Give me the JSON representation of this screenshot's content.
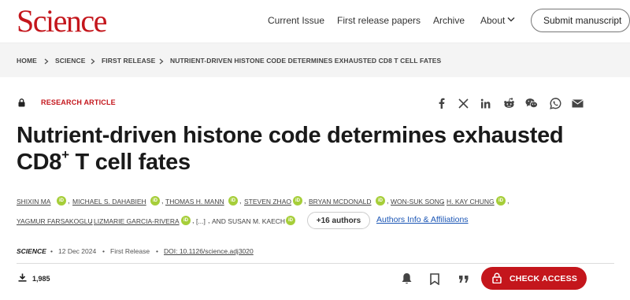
{
  "header": {
    "logo": "Science",
    "nav": [
      "Current Issue",
      "First release papers",
      "Archive",
      "About"
    ],
    "submit": "Submit manuscript"
  },
  "breadcrumb": [
    "HOME",
    "SCIENCE",
    "FIRST RELEASE",
    "NUTRIENT-DRIVEN HISTONE CODE DETERMINES EXHAUSTED CD8 T CELL FATES"
  ],
  "article": {
    "type": "RESEARCH ARTICLE",
    "title_main": "Nutrient-driven histone code determines exhausted CD8",
    "title_sup": "+",
    "title_end": " T cell fates",
    "authors_row1": [
      "SHIXIN MA",
      "MICHAEL S. DAHABIEH",
      "THOMAS H. MANN",
      "STEVEN ZHAO",
      "BRYAN MCDONALD",
      "WON-SUK SONG",
      "H. KAY CHUNG"
    ],
    "authors_row2": [
      "YAGMUR FARSAKOGLU",
      "LIZMARIE GARCIA-RIVERA",
      "[...]",
      "AND SUSAN M. KAECH"
    ],
    "plus_authors": "+16 authors",
    "affiliations": "Authors Info & Affiliations",
    "orcid_label": "iD"
  },
  "meta": {
    "journal": "SCIENCE",
    "sep": "•",
    "date": "12 Dec 2024",
    "status": "First Release",
    "doi": "DOI: 10.1126/science.adj3020"
  },
  "actions": {
    "downloads": "1,985",
    "check_access": "CHECK ACCESS"
  },
  "colors": {
    "brand": "#c4161c",
    "link": "#1a55b5",
    "orcid": "#a6ce39"
  },
  "icons": [
    "lock-icon",
    "facebook-icon",
    "x-icon",
    "linkedin-icon",
    "reddit-icon",
    "wechat-icon",
    "whatsapp-icon",
    "email-icon",
    "download-icon",
    "bell-icon",
    "bookmark-icon",
    "quote-icon",
    "chevron-down-icon"
  ]
}
